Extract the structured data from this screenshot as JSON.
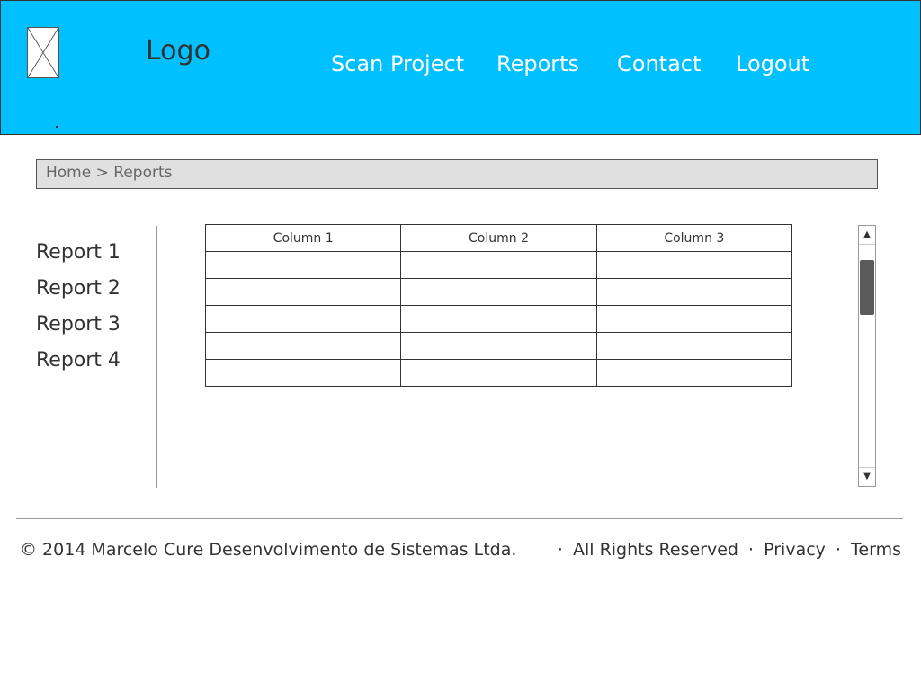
{
  "header": {
    "logo_text": "Logo",
    "nav": [
      "Scan Project",
      "Reports",
      "Contact",
      "Logout"
    ]
  },
  "breadcrumb": {
    "home": "Home",
    "separator": ">",
    "current": "Reports"
  },
  "sidebar": {
    "items": [
      {
        "label": "Report 1"
      },
      {
        "label": "Report 2"
      },
      {
        "label": "Report 3"
      },
      {
        "label": "Report 4"
      }
    ]
  },
  "table": {
    "columns": [
      "Column 1",
      "Column 2",
      "Column 3"
    ],
    "rows": [
      [
        "",
        "",
        ""
      ],
      [
        "",
        "",
        ""
      ],
      [
        "",
        "",
        ""
      ],
      [
        "",
        "",
        ""
      ],
      [
        "",
        "",
        ""
      ]
    ]
  },
  "scrollbar": {
    "up_glyph": "▲",
    "down_glyph": "▼"
  },
  "footer": {
    "copyright": "© 2014 Marcelo Cure Desenvolvimento de Sistemas Ltda.",
    "links": [
      "All Rights Reserved",
      "Privacy",
      "Terms"
    ],
    "separator": "·"
  },
  "colors": {
    "header_bg": "#00c0ff",
    "breadcrumb_bg": "#e0e0e0",
    "text": "#333333"
  }
}
